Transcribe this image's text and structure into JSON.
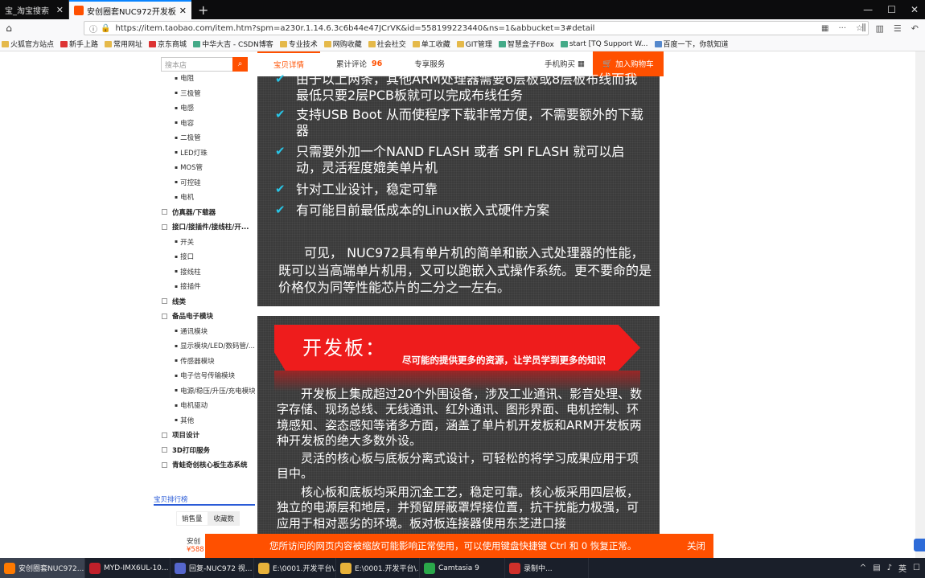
{
  "browser": {
    "tabs": [
      {
        "title": "宝_淘宝搜索",
        "active": false
      },
      {
        "title": "安创圈套NUC972开发板ARM",
        "active": true
      }
    ],
    "url": "https://item.taobao.com/item.htm?spm=a230r.1.14.6.3c6b44e47JCrVK&id=558199223440&ns=1&abbucket=3#detail",
    "bookmarks": [
      "火狐官方站点",
      "新手上路",
      "常用网址",
      "京东商城",
      "中华大吉 - CSDN博客",
      "专业技术",
      "网购收藏",
      "社会社交",
      "单工收藏",
      "GIT管理",
      "智慧盒子FBox",
      "start [TQ Support W...",
      "百度一下，你就知道"
    ]
  },
  "sidebar": {
    "search_placeholder": "搜本店",
    "search_icon": "search-icon",
    "categories": [
      {
        "label": "电阻",
        "level": "sub"
      },
      {
        "label": "三极管",
        "level": "sub"
      },
      {
        "label": "电感",
        "level": "sub"
      },
      {
        "label": "电容",
        "level": "sub"
      },
      {
        "label": "二极管",
        "level": "sub"
      },
      {
        "label": "LED灯珠",
        "level": "sub"
      },
      {
        "label": "MOS管",
        "level": "sub"
      },
      {
        "label": "可控硅",
        "level": "sub"
      },
      {
        "label": "电机",
        "level": "sub"
      },
      {
        "label": "仿真器/下载器",
        "level": "main",
        "box": "+"
      },
      {
        "label": "接口/接插件/接线柱/开...",
        "level": "main",
        "box": "−"
      },
      {
        "label": "开关",
        "level": "sub"
      },
      {
        "label": "接口",
        "level": "sub"
      },
      {
        "label": "接线柱",
        "level": "sub"
      },
      {
        "label": "接插件",
        "level": "sub"
      },
      {
        "label": "线类",
        "level": "main",
        "box": "+"
      },
      {
        "label": "备品电子模块",
        "level": "main",
        "box": "−"
      },
      {
        "label": "通讯模块",
        "level": "sub"
      },
      {
        "label": "显示模块/LED/数码管/...",
        "level": "sub"
      },
      {
        "label": "传感器模块",
        "level": "sub"
      },
      {
        "label": "电子信号传输模块",
        "level": "sub"
      },
      {
        "label": "电源/稳压/升压/充电模块",
        "level": "sub"
      },
      {
        "label": "电机驱动",
        "level": "sub"
      },
      {
        "label": "其他",
        "level": "sub"
      },
      {
        "label": "项目设计",
        "level": "main",
        "box": "+"
      },
      {
        "label": "3D打印服务",
        "level": "main",
        "box": "+"
      },
      {
        "label": "青蛙奇创核心板生态系统",
        "level": "main",
        "box": "+"
      }
    ],
    "rank_title": "宝贝排行榜",
    "rank_tabs": [
      "销售量",
      "收藏数"
    ],
    "rank_item": {
      "name": "安创",
      "price": "¥588"
    }
  },
  "detail_tabs": {
    "tabs": [
      {
        "label": "宝贝详情",
        "active": true
      },
      {
        "label": "累计评论",
        "count": "96"
      },
      {
        "label": "专享服务"
      }
    ],
    "phone": "手机购买",
    "phone_icon": "qr-icon",
    "cart": "加入购物车",
    "cart_icon": "cart-icon"
  },
  "panel1": {
    "features": [
      "由于以上两条，其他ARM处理器需要6层板或8层板布线而我最低只要2层PCB板就可以完成布线任务",
      "支持USB Boot 从而使程序下载非常方便，不需要额外的下载器",
      "只需要外加一个NAND FLASH 或者 SPI FLASH 就可以启动，灵活程度媲美单片机",
      "针对工业设计，稳定可靠",
      "有可能目前最低成本的Linux嵌入式硬件方案"
    ],
    "check_icon": "check-icon",
    "paragraph": "可见， NUC972具有单片机的简单和嵌入式处理器的性能，既可以当高端单片机用，又可以跑嵌入式操作系统。更不要命的是价格仅为同等性能芯片的二分之一左右。"
  },
  "panel2": {
    "ribbon_title": "开发板：",
    "ribbon_subtitle": "尽可能的提供更多的资源，让学员学到更多的知识",
    "paragraphs": [
      "开发板上集成超过20个外围设备，涉及工业通讯、影音处理、数字存储、现场总线、无线通讯、红外通讯、图形界面、电机控制、环境感知、姿态感知等诸多方面，涵盖了单片机开发板和ARM开发板两种开发板的绝大多数外设。",
      "灵活的核心板与底板分离式设计，可轻松的将学习成果应用于项目中。",
      "核心板和底板均采用沉金工艺，稳定可靠。核心板采用四层板，独立的电源层和地层，并预留屏蔽罩焊接位置，抗干扰能力极强，可应用于相对恶劣的环境。板对板连接器使用东芝进口接"
    ]
  },
  "notice": {
    "message": "您所访问的网页内容被缩放可能影响正常使用，可以使用键盘快捷键 Ctrl 和 0 恢复正常。",
    "close": "关闭"
  },
  "taskbar": {
    "items": [
      {
        "label": "安创圈套NUC972...",
        "active": true
      },
      {
        "label": "MYD-IMX6UL-10..."
      },
      {
        "label": "回复-NUC972 视..."
      },
      {
        "label": "E:\\0001.开发平台\\..."
      },
      {
        "label": "E:\\0001.开发平台\\..."
      },
      {
        "label": "Camtasia 9"
      },
      {
        "label": "录制中..."
      }
    ],
    "colors": [
      "#ff7a00",
      "#c0202a",
      "#5566cc",
      "#e8b23a",
      "#e8b23a",
      "#2aa84a",
      "#d0302a"
    ]
  }
}
